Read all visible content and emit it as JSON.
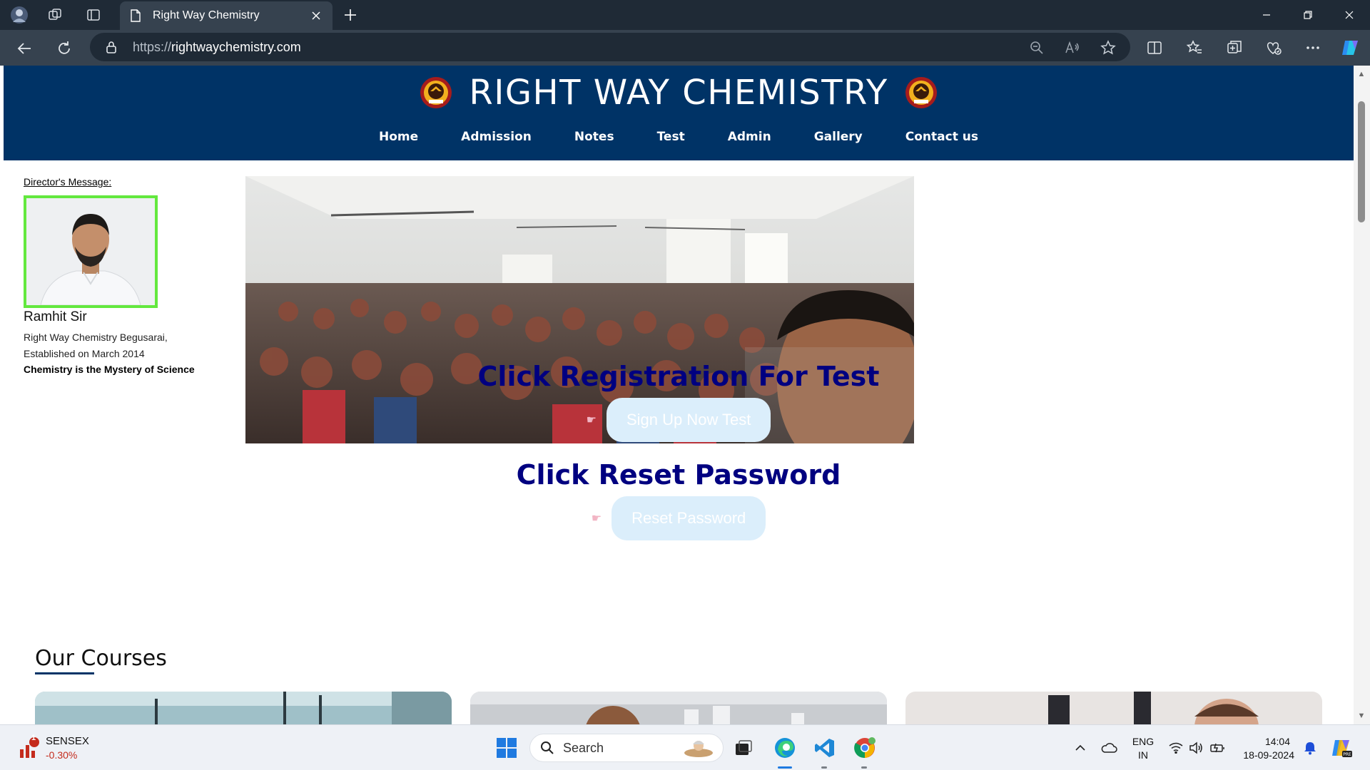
{
  "browser": {
    "tab_title": "Right Way Chemistry",
    "url_protocol": "https://",
    "url_host": "rightwaychemistry.com"
  },
  "site": {
    "title": "RIGHT WAY CHEMISTRY",
    "nav": [
      "Home",
      "Admission",
      "Notes",
      "Test",
      "Admin",
      "Gallery",
      "Contact us"
    ]
  },
  "director": {
    "label": "Director's Message:",
    "name": "Ramhit Sir",
    "line1": "Right Way Chemistry Begusarai,",
    "line2": "Established on March 2014",
    "motto": "Chemistry is the Mystery of Science"
  },
  "cta": {
    "registration_title": "Click Registration For Test",
    "registration_button": "Sign Up Now Test",
    "reset_title": "Click Reset Password",
    "reset_button": "Reset Password",
    "hand_glyph": "☛"
  },
  "courses": {
    "title": "Our Courses"
  },
  "taskbar": {
    "ticker_name": "SENSEX",
    "ticker_change": "-0.30%",
    "ticker_badge": "1",
    "search_label": "Search",
    "lang_top": "ENG",
    "lang_bottom": "IN",
    "time": "14:04",
    "date": "18-09-2024"
  },
  "colors": {
    "header_bg": "#003366",
    "cta_title": "#000080",
    "button_bg": "#dbeefb",
    "director_photo_border": "#63e83e"
  }
}
